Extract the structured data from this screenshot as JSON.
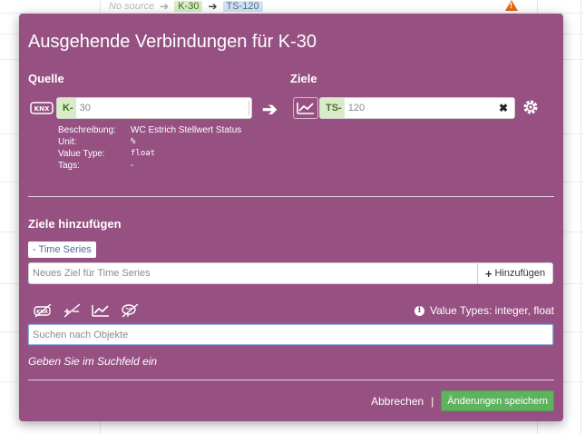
{
  "background": {
    "no_source": "No source",
    "source_tag": "K-30",
    "target_tag": "TS-120"
  },
  "modal": {
    "title": "Ausgehende Verbindungen für K-30",
    "source_label": "Quelle",
    "targets_label": "Ziele",
    "source": {
      "prefix": "K-",
      "value": "30"
    },
    "target": {
      "prefix": "TS-",
      "value": "120"
    },
    "details": {
      "description_label": "Beschreibung:",
      "description_value": "WC Estrich Stellwert Status",
      "unit_label": "Unit:",
      "unit_value": "%",
      "value_type_label": "Value Type:",
      "value_type_value": "float",
      "tags_label": "Tags:",
      "tags_value": "-"
    },
    "add_targets_label": "Ziele hinzufügen",
    "type_chip": "- Time Series",
    "new_target_placeholder": "Neues Ziel für Time Series",
    "add_button": "Hinzufügen",
    "value_types_text": "Value Types: integer, float",
    "search_placeholder": "Suchen nach Objekte",
    "hint": "Geben Sie im Suchfeld ein",
    "cancel": "Abbrechen",
    "separator": "|",
    "save": "Änderungen speichern"
  },
  "colors": {
    "modal_bg": "#965082",
    "save_button": "#5fb35f",
    "tag_green": "#d9ecc7",
    "tag_blue": "#d4e3f3",
    "warning": "#e26a1b"
  },
  "icons": {
    "source_type": "knx-icon",
    "target_type": "chart-line-icon",
    "target_settings": "gear-icon",
    "connect_arrow": "arrow-right-icon",
    "filters": [
      "knx-filter-icon",
      "math-filter-icon",
      "chart-filter-icon",
      "brain-filter-icon"
    ]
  }
}
